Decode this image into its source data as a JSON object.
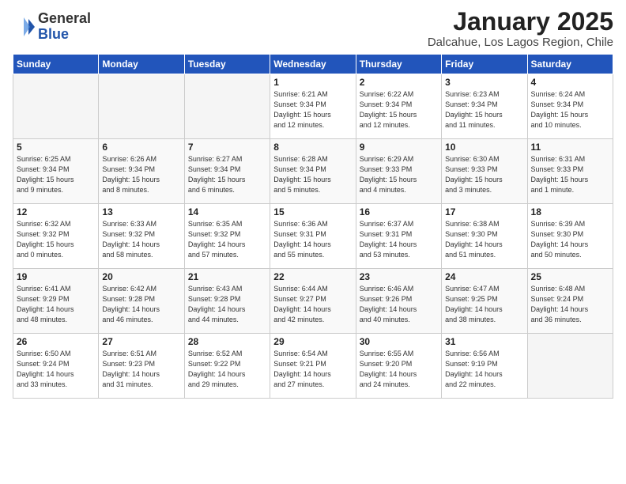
{
  "logo": {
    "general": "General",
    "blue": "Blue"
  },
  "title": "January 2025",
  "subtitle": "Dalcahue, Los Lagos Region, Chile",
  "weekdays": [
    "Sunday",
    "Monday",
    "Tuesday",
    "Wednesday",
    "Thursday",
    "Friday",
    "Saturday"
  ],
  "weeks": [
    [
      {
        "day": "",
        "info": ""
      },
      {
        "day": "",
        "info": ""
      },
      {
        "day": "",
        "info": ""
      },
      {
        "day": "1",
        "info": "Sunrise: 6:21 AM\nSunset: 9:34 PM\nDaylight: 15 hours\nand 12 minutes."
      },
      {
        "day": "2",
        "info": "Sunrise: 6:22 AM\nSunset: 9:34 PM\nDaylight: 15 hours\nand 12 minutes."
      },
      {
        "day": "3",
        "info": "Sunrise: 6:23 AM\nSunset: 9:34 PM\nDaylight: 15 hours\nand 11 minutes."
      },
      {
        "day": "4",
        "info": "Sunrise: 6:24 AM\nSunset: 9:34 PM\nDaylight: 15 hours\nand 10 minutes."
      }
    ],
    [
      {
        "day": "5",
        "info": "Sunrise: 6:25 AM\nSunset: 9:34 PM\nDaylight: 15 hours\nand 9 minutes."
      },
      {
        "day": "6",
        "info": "Sunrise: 6:26 AM\nSunset: 9:34 PM\nDaylight: 15 hours\nand 8 minutes."
      },
      {
        "day": "7",
        "info": "Sunrise: 6:27 AM\nSunset: 9:34 PM\nDaylight: 15 hours\nand 6 minutes."
      },
      {
        "day": "8",
        "info": "Sunrise: 6:28 AM\nSunset: 9:34 PM\nDaylight: 15 hours\nand 5 minutes."
      },
      {
        "day": "9",
        "info": "Sunrise: 6:29 AM\nSunset: 9:33 PM\nDaylight: 15 hours\nand 4 minutes."
      },
      {
        "day": "10",
        "info": "Sunrise: 6:30 AM\nSunset: 9:33 PM\nDaylight: 15 hours\nand 3 minutes."
      },
      {
        "day": "11",
        "info": "Sunrise: 6:31 AM\nSunset: 9:33 PM\nDaylight: 15 hours\nand 1 minute."
      }
    ],
    [
      {
        "day": "12",
        "info": "Sunrise: 6:32 AM\nSunset: 9:32 PM\nDaylight: 15 hours\nand 0 minutes."
      },
      {
        "day": "13",
        "info": "Sunrise: 6:33 AM\nSunset: 9:32 PM\nDaylight: 14 hours\nand 58 minutes."
      },
      {
        "day": "14",
        "info": "Sunrise: 6:35 AM\nSunset: 9:32 PM\nDaylight: 14 hours\nand 57 minutes."
      },
      {
        "day": "15",
        "info": "Sunrise: 6:36 AM\nSunset: 9:31 PM\nDaylight: 14 hours\nand 55 minutes."
      },
      {
        "day": "16",
        "info": "Sunrise: 6:37 AM\nSunset: 9:31 PM\nDaylight: 14 hours\nand 53 minutes."
      },
      {
        "day": "17",
        "info": "Sunrise: 6:38 AM\nSunset: 9:30 PM\nDaylight: 14 hours\nand 51 minutes."
      },
      {
        "day": "18",
        "info": "Sunrise: 6:39 AM\nSunset: 9:30 PM\nDaylight: 14 hours\nand 50 minutes."
      }
    ],
    [
      {
        "day": "19",
        "info": "Sunrise: 6:41 AM\nSunset: 9:29 PM\nDaylight: 14 hours\nand 48 minutes."
      },
      {
        "day": "20",
        "info": "Sunrise: 6:42 AM\nSunset: 9:28 PM\nDaylight: 14 hours\nand 46 minutes."
      },
      {
        "day": "21",
        "info": "Sunrise: 6:43 AM\nSunset: 9:28 PM\nDaylight: 14 hours\nand 44 minutes."
      },
      {
        "day": "22",
        "info": "Sunrise: 6:44 AM\nSunset: 9:27 PM\nDaylight: 14 hours\nand 42 minutes."
      },
      {
        "day": "23",
        "info": "Sunrise: 6:46 AM\nSunset: 9:26 PM\nDaylight: 14 hours\nand 40 minutes."
      },
      {
        "day": "24",
        "info": "Sunrise: 6:47 AM\nSunset: 9:25 PM\nDaylight: 14 hours\nand 38 minutes."
      },
      {
        "day": "25",
        "info": "Sunrise: 6:48 AM\nSunset: 9:24 PM\nDaylight: 14 hours\nand 36 minutes."
      }
    ],
    [
      {
        "day": "26",
        "info": "Sunrise: 6:50 AM\nSunset: 9:24 PM\nDaylight: 14 hours\nand 33 minutes."
      },
      {
        "day": "27",
        "info": "Sunrise: 6:51 AM\nSunset: 9:23 PM\nDaylight: 14 hours\nand 31 minutes."
      },
      {
        "day": "28",
        "info": "Sunrise: 6:52 AM\nSunset: 9:22 PM\nDaylight: 14 hours\nand 29 minutes."
      },
      {
        "day": "29",
        "info": "Sunrise: 6:54 AM\nSunset: 9:21 PM\nDaylight: 14 hours\nand 27 minutes."
      },
      {
        "day": "30",
        "info": "Sunrise: 6:55 AM\nSunset: 9:20 PM\nDaylight: 14 hours\nand 24 minutes."
      },
      {
        "day": "31",
        "info": "Sunrise: 6:56 AM\nSunset: 9:19 PM\nDaylight: 14 hours\nand 22 minutes."
      },
      {
        "day": "",
        "info": ""
      }
    ]
  ]
}
